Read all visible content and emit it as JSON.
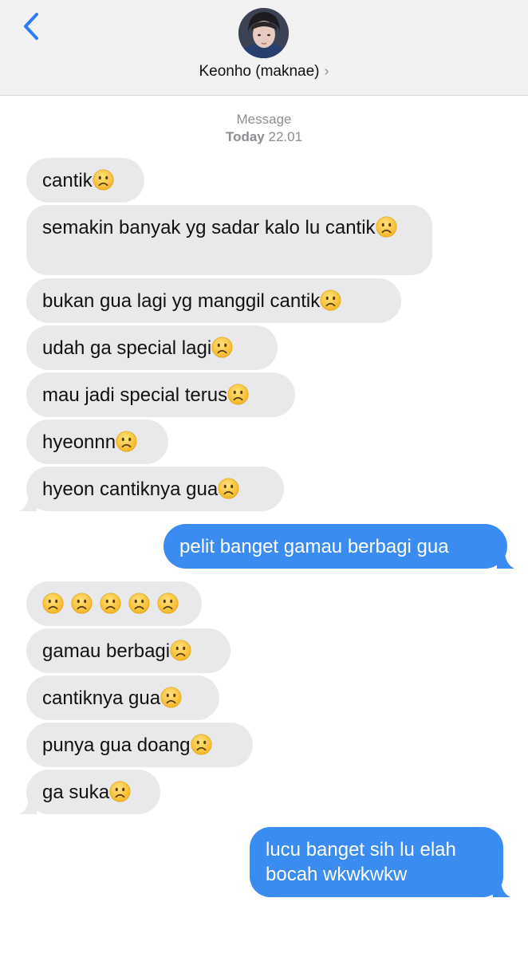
{
  "header": {
    "back_icon": "chevron-left-icon",
    "contact_name": "Keonho (maknae)",
    "chevron": "›"
  },
  "meta": {
    "service": "Message",
    "day": "Today",
    "time": "22.01"
  },
  "messages": [
    {
      "dir": "in",
      "text": "cantik",
      "emoji": 1
    },
    {
      "dir": "in",
      "text": "semakin banyak yg sadar kalo lu cantik",
      "emoji": 1
    },
    {
      "dir": "in",
      "text": "bukan gua lagi yg manggil cantik",
      "emoji": 1
    },
    {
      "dir": "in",
      "text": "udah ga special lagi",
      "emoji": 1
    },
    {
      "dir": "in",
      "text": "mau jadi special terus",
      "emoji": 1
    },
    {
      "dir": "in",
      "text": "hyeonnn",
      "emoji": 1
    },
    {
      "dir": "in",
      "text": "hyeon cantiknya gua",
      "emoji": 1
    },
    {
      "dir": "out",
      "text": "pelit banget gamau berbagi gua"
    },
    {
      "dir": "in",
      "text": "",
      "emoji": 5
    },
    {
      "dir": "in",
      "text": "gamau berbagi",
      "emoji": 1
    },
    {
      "dir": "in",
      "text": "cantiknya gua",
      "emoji": 1
    },
    {
      "dir": "in",
      "text": "punya gua doang",
      "emoji": 1
    },
    {
      "dir": "in",
      "text": "ga suka",
      "emoji": 1
    },
    {
      "dir": "out",
      "text": "lucu banget sih lu elah bocah wkwkwkw"
    }
  ],
  "emoji_name": "frowning-face-emoji",
  "colors": {
    "incoming_bubble": "#e9e9eb",
    "outgoing_bubble": "#3b8cf0",
    "accent": "#2f7df6"
  }
}
